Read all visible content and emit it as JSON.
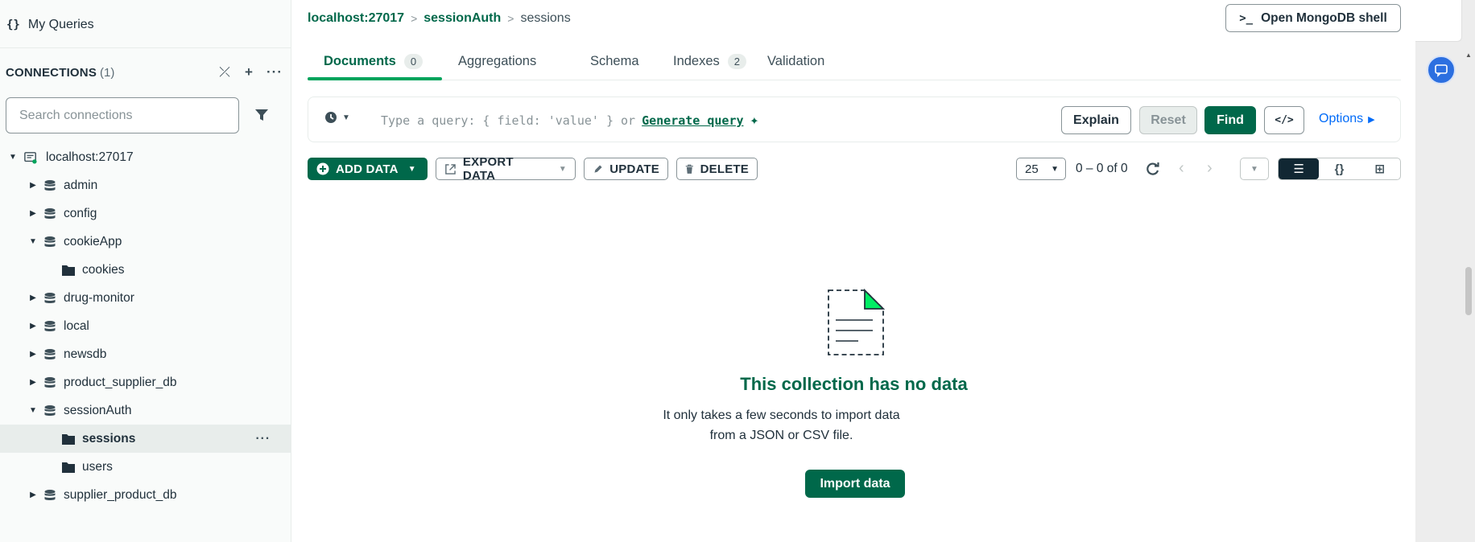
{
  "sidebar": {
    "my_queries_icon": "{}",
    "my_queries_label": "My Queries",
    "connections_title": "CONNECTIONS",
    "connections_count": "(1)",
    "collapse_icon_glyph": "⤫",
    "add_icon_glyph": "+",
    "more_icon_glyph": "···",
    "search_placeholder": "Search connections",
    "tree": [
      {
        "label": "localhost:27017",
        "kind": "connection",
        "caret": "▼"
      },
      {
        "label": "admin",
        "kind": "database",
        "caret": "▶"
      },
      {
        "label": "config",
        "kind": "database",
        "caret": "▶"
      },
      {
        "label": "cookieApp",
        "kind": "database",
        "caret": "▼"
      },
      {
        "label": "cookies",
        "kind": "collection",
        "caret": ""
      },
      {
        "label": "drug-monitor",
        "kind": "database",
        "caret": "▶"
      },
      {
        "label": "local",
        "kind": "database",
        "caret": "▶"
      },
      {
        "label": "newsdb",
        "kind": "database",
        "caret": "▶"
      },
      {
        "label": "product_supplier_db",
        "kind": "database",
        "caret": "▶"
      },
      {
        "label": "sessionAuth",
        "kind": "database",
        "caret": "▼"
      },
      {
        "label": "sessions",
        "kind": "collection",
        "caret": "",
        "selected": true,
        "more": "···"
      },
      {
        "label": "users",
        "kind": "collection",
        "caret": ""
      },
      {
        "label": "supplier_product_db",
        "kind": "database",
        "caret": "▶"
      }
    ]
  },
  "header": {
    "breadcrumb": [
      "localhost:27017",
      "sessionAuth",
      "sessions"
    ],
    "breadcrumb_sep": ">",
    "shell_prompt": ">_",
    "shell_label": "Open MongoDB shell"
  },
  "tabs": [
    {
      "label": "Documents",
      "badge": "0",
      "active": true
    },
    {
      "label": "Aggregations"
    },
    {
      "label": "Schema"
    },
    {
      "label": "Indexes",
      "badge": "2"
    },
    {
      "label": "Validation"
    }
  ],
  "query_bar": {
    "placeholder": "Type a query: { field: 'value' } or",
    "generate_query": "Generate query",
    "explain": "Explain",
    "reset": "Reset",
    "find": "Find",
    "code_toggle": "</>",
    "options": "Options"
  },
  "toolbar": {
    "add_data": "ADD DATA",
    "export_data": "EXPORT DATA",
    "update": "UPDATE",
    "delete": "DELETE",
    "page_size": "25",
    "page_info": "0 – 0 of 0",
    "view_list": "☰",
    "view_json": "{}",
    "view_table": "⊞"
  },
  "empty_state": {
    "title": "This collection has no data",
    "description": "It only takes a few seconds to import data from a JSON or CSV file.",
    "import_button": "Import data"
  },
  "colors": {
    "brand_green": "#00684a",
    "accent_green": "#00a35c",
    "link_blue": "#016bf8",
    "dark_toggle": "#112733"
  }
}
